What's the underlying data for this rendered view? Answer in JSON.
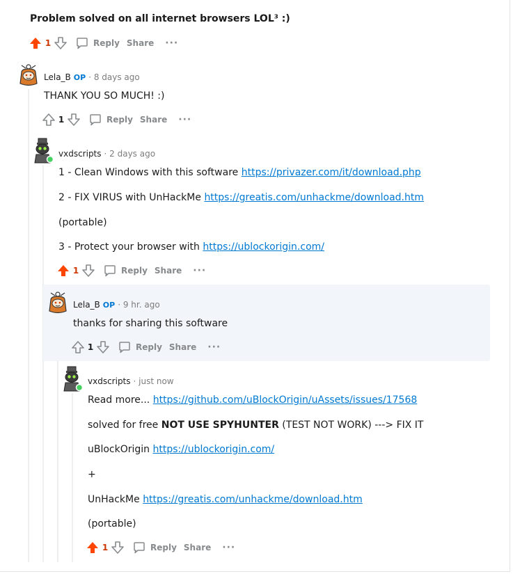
{
  "post": {
    "title": "Problem solved on all internet browsers LOL³ :)",
    "score": "1"
  },
  "actions": {
    "reply": "Reply",
    "share": "Share",
    "more": "···"
  },
  "comments": [
    {
      "username": "Lela_B",
      "op": "OP",
      "time": "· 8 days ago",
      "lines": [
        "THANK YOU SO MUCH! :)"
      ],
      "score": "1"
    },
    {
      "username": "vxdscripts",
      "time": "· 2 days ago",
      "line1_text": "1 - Clean Windows with this software ",
      "line1_link": "https://privazer.com/it/download.php",
      "line2_text": "2 - FIX VIRUS with UnHackMe ",
      "line2_link": "https://greatis.com/unhackme/download.htm",
      "line3_text": "(portable)",
      "line4_text": "3 - Protect your browser with ",
      "line4_link": "https://ublockorigin.com/",
      "score": "1"
    },
    {
      "username": "Lela_B",
      "op": "OP",
      "time": "· 9 hr. ago",
      "lines": [
        "thanks for sharing this software"
      ],
      "score": "1"
    },
    {
      "username": "vxdscripts",
      "time": "· just now",
      "line1_text": "Read more... ",
      "line1_link": "https://github.com/uBlockOrigin/uAssets/issues/17568",
      "line2_pre": "solved for free ",
      "line2_bold": "NOT USE SPYHUNTER",
      "line2_post": " (TEST NOT WORK) ---> FIX IT",
      "line3_text": "uBlockOrigin ",
      "line3_link": "https://ublockorigin.com/",
      "line4_text": "+",
      "line5_text": "UnHackMe ",
      "line5_link": "https://greatis.com/unhackme/download.htm",
      "line6_text": "(portable)",
      "score": "1"
    }
  ],
  "colors": {
    "upvoted": "#ff4500",
    "link": "#0079d3",
    "highlight": "#f2f5fa"
  },
  "icons": [
    "upvote-icon",
    "downvote-icon",
    "comment-icon",
    "more-icon",
    "snoo-avatar-icon"
  ]
}
